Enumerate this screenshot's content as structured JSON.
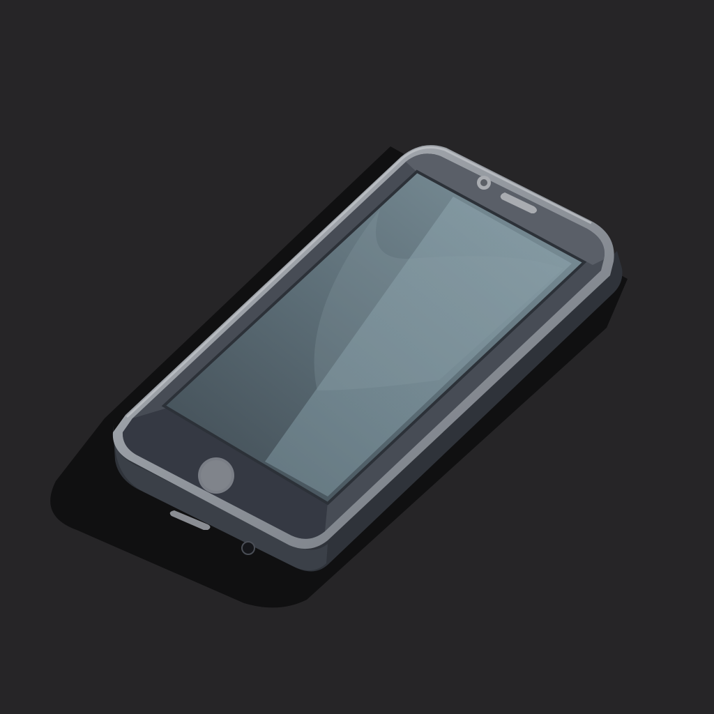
{
  "scene": {
    "subject": "smartphone-illustration",
    "view": "isometric",
    "screen_state": "off",
    "colors": {
      "background": "#262527",
      "shadow": "#0f0f10",
      "body_side": "#3a3e46",
      "body_side_dark": "#2b2e35",
      "frame_rim": "#8c9299",
      "frame_rim_light": "#aeb3b8",
      "bezel": "#4a4f58",
      "bezel_dark": "#343842",
      "screen_dark": "#4d5961",
      "screen_light": "#7b909a",
      "screen_highlight": "#8aa0a9",
      "button": "#7d8087",
      "speaker": "#a9acb1"
    }
  }
}
